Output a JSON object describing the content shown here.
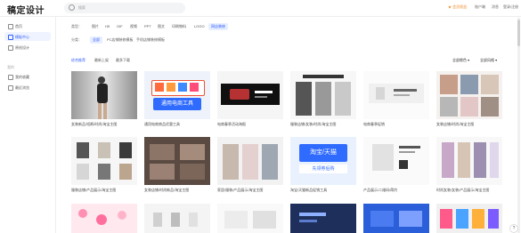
{
  "app": {
    "logo_text": "稿定设计"
  },
  "search": {
    "placeholder": "搜索"
  },
  "header_right": {
    "vip": "★ 会员权益",
    "members": "账户端",
    "notifications": "消息",
    "login": "登录/注册"
  },
  "sidebar": {
    "items": [
      {
        "label": "首页",
        "icon": "home-icon"
      },
      {
        "label": "模板中心",
        "icon": "template-icon",
        "active": true
      },
      {
        "label": "原创设计",
        "icon": "design-icon"
      }
    ],
    "group_label": "我的",
    "group_items": [
      {
        "label": "我的收藏",
        "icon": "star-icon"
      },
      {
        "label": "最近浏览",
        "icon": "history-icon"
      }
    ]
  },
  "filters": {
    "row1_label": "类型：",
    "row1": [
      "全部",
      "图片",
      "H5",
      "GIF",
      "视频",
      "PPT",
      "图文",
      "印刷物料",
      "LOGO",
      "网店装修"
    ],
    "row1_active": "网店装修",
    "row2_label": "分类：",
    "row2": [
      "全部",
      "PC店铺装修模板",
      "手机店铺装修模板"
    ],
    "row2_active": "全部"
  },
  "sort": {
    "options": [
      "综合推荐",
      "最新上架",
      "最多下载"
    ],
    "active": "综合推荐",
    "dropdown1": "全部颜色 ▾",
    "dropdown2": "全部风格 ▾"
  },
  "cards": [
    {
      "caption": "女装新品/短裤/时尚/淘宝主图",
      "thumb": "fashion-woman"
    },
    {
      "caption": "通用电商商品优惠工具",
      "thumb": "coupon-blue"
    },
    {
      "caption": "电商春季活动海报",
      "thumb": "dark-banner"
    },
    {
      "caption": "服装店铺/女装/时尚/淘宝主图",
      "thumb": "clothing-grid"
    },
    {
      "caption": "电商春季促销",
      "thumb": "light-banner"
    },
    {
      "caption": "女装店铺/时尚/淘宝主图",
      "thumb": "women-grid"
    },
    {
      "caption": "服装店铺/产品展示/淘宝主图",
      "thumb": "clothing-list"
    },
    {
      "caption": "女装店铺/时尚新品/淘宝主图",
      "thumb": "brown-grid"
    },
    {
      "caption": "家居/服装/产品展示/淘宝主图",
      "thumb": "model-grid"
    },
    {
      "caption": "淘宝/天猫新品促销工具",
      "thumb": "coupon-blue2"
    },
    {
      "caption": "产品展示/二维码/简约",
      "thumb": "white-product"
    },
    {
      "caption": "时尚女装/女装/产品展示/淘宝主图",
      "thumb": "dress-list"
    },
    {
      "caption": "",
      "thumb": "pink-flowers"
    },
    {
      "caption": "",
      "thumb": "white-items"
    },
    {
      "caption": "",
      "thumb": "cards-light"
    },
    {
      "caption": "",
      "thumb": "navy-banner"
    },
    {
      "caption": "",
      "thumb": "blue-panel"
    },
    {
      "caption": "",
      "thumb": "colorful-grid"
    }
  ],
  "coupon_text": {
    "a": "通用电商工具",
    "b": "淘宝/天猫",
    "c": "先领券后购"
  },
  "help_glyph": "?"
}
